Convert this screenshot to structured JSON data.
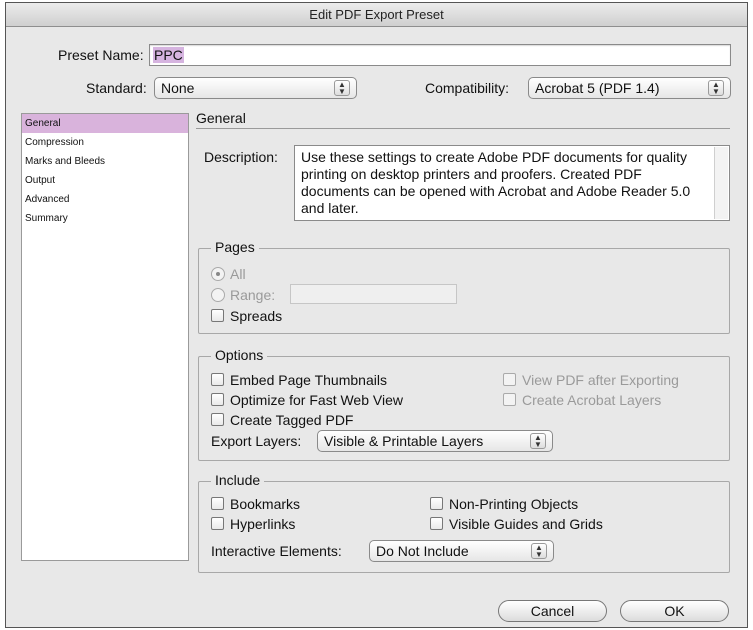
{
  "window": {
    "title": "Edit PDF Export Preset"
  },
  "preset": {
    "label": "Preset Name:",
    "value": "PPC"
  },
  "standard": {
    "label": "Standard:",
    "value": "None"
  },
  "compatibility": {
    "label": "Compatibility:",
    "value": "Acrobat 5 (PDF 1.4)"
  },
  "sidebar": {
    "items": [
      {
        "label": "General",
        "active": true
      },
      {
        "label": "Compression",
        "active": false
      },
      {
        "label": "Marks and Bleeds",
        "active": false
      },
      {
        "label": "Output",
        "active": false
      },
      {
        "label": "Advanced",
        "active": false
      },
      {
        "label": "Summary",
        "active": false
      }
    ]
  },
  "general": {
    "title": "General",
    "description_label": "Description:",
    "description": "Use these settings to create Adobe PDF documents for quality printing on desktop printers and proofers.  Created PDF documents can be opened with Acrobat and Adobe Reader 5.0 and later."
  },
  "pages": {
    "title": "Pages",
    "all_label": "All",
    "range_label": "Range:",
    "spreads_label": "Spreads"
  },
  "options": {
    "title": "Options",
    "embed_thumbnails": "Embed Page Thumbnails",
    "optimize_web": "Optimize for Fast Web View",
    "tagged_pdf": "Create Tagged PDF",
    "view_after": "View PDF after Exporting",
    "acrobat_layers": "Create Acrobat Layers",
    "export_layers_label": "Export Layers:",
    "export_layers_value": "Visible & Printable Layers"
  },
  "include": {
    "title": "Include",
    "bookmarks": "Bookmarks",
    "hyperlinks": "Hyperlinks",
    "non_printing": "Non-Printing Objects",
    "visible_guides": "Visible Guides and Grids",
    "interactive_label": "Interactive Elements:",
    "interactive_value": "Do Not Include"
  },
  "buttons": {
    "cancel": "Cancel",
    "ok": "OK"
  },
  "colors": {
    "accent": "#d9b3dc",
    "selection": "#d6b4e0"
  }
}
